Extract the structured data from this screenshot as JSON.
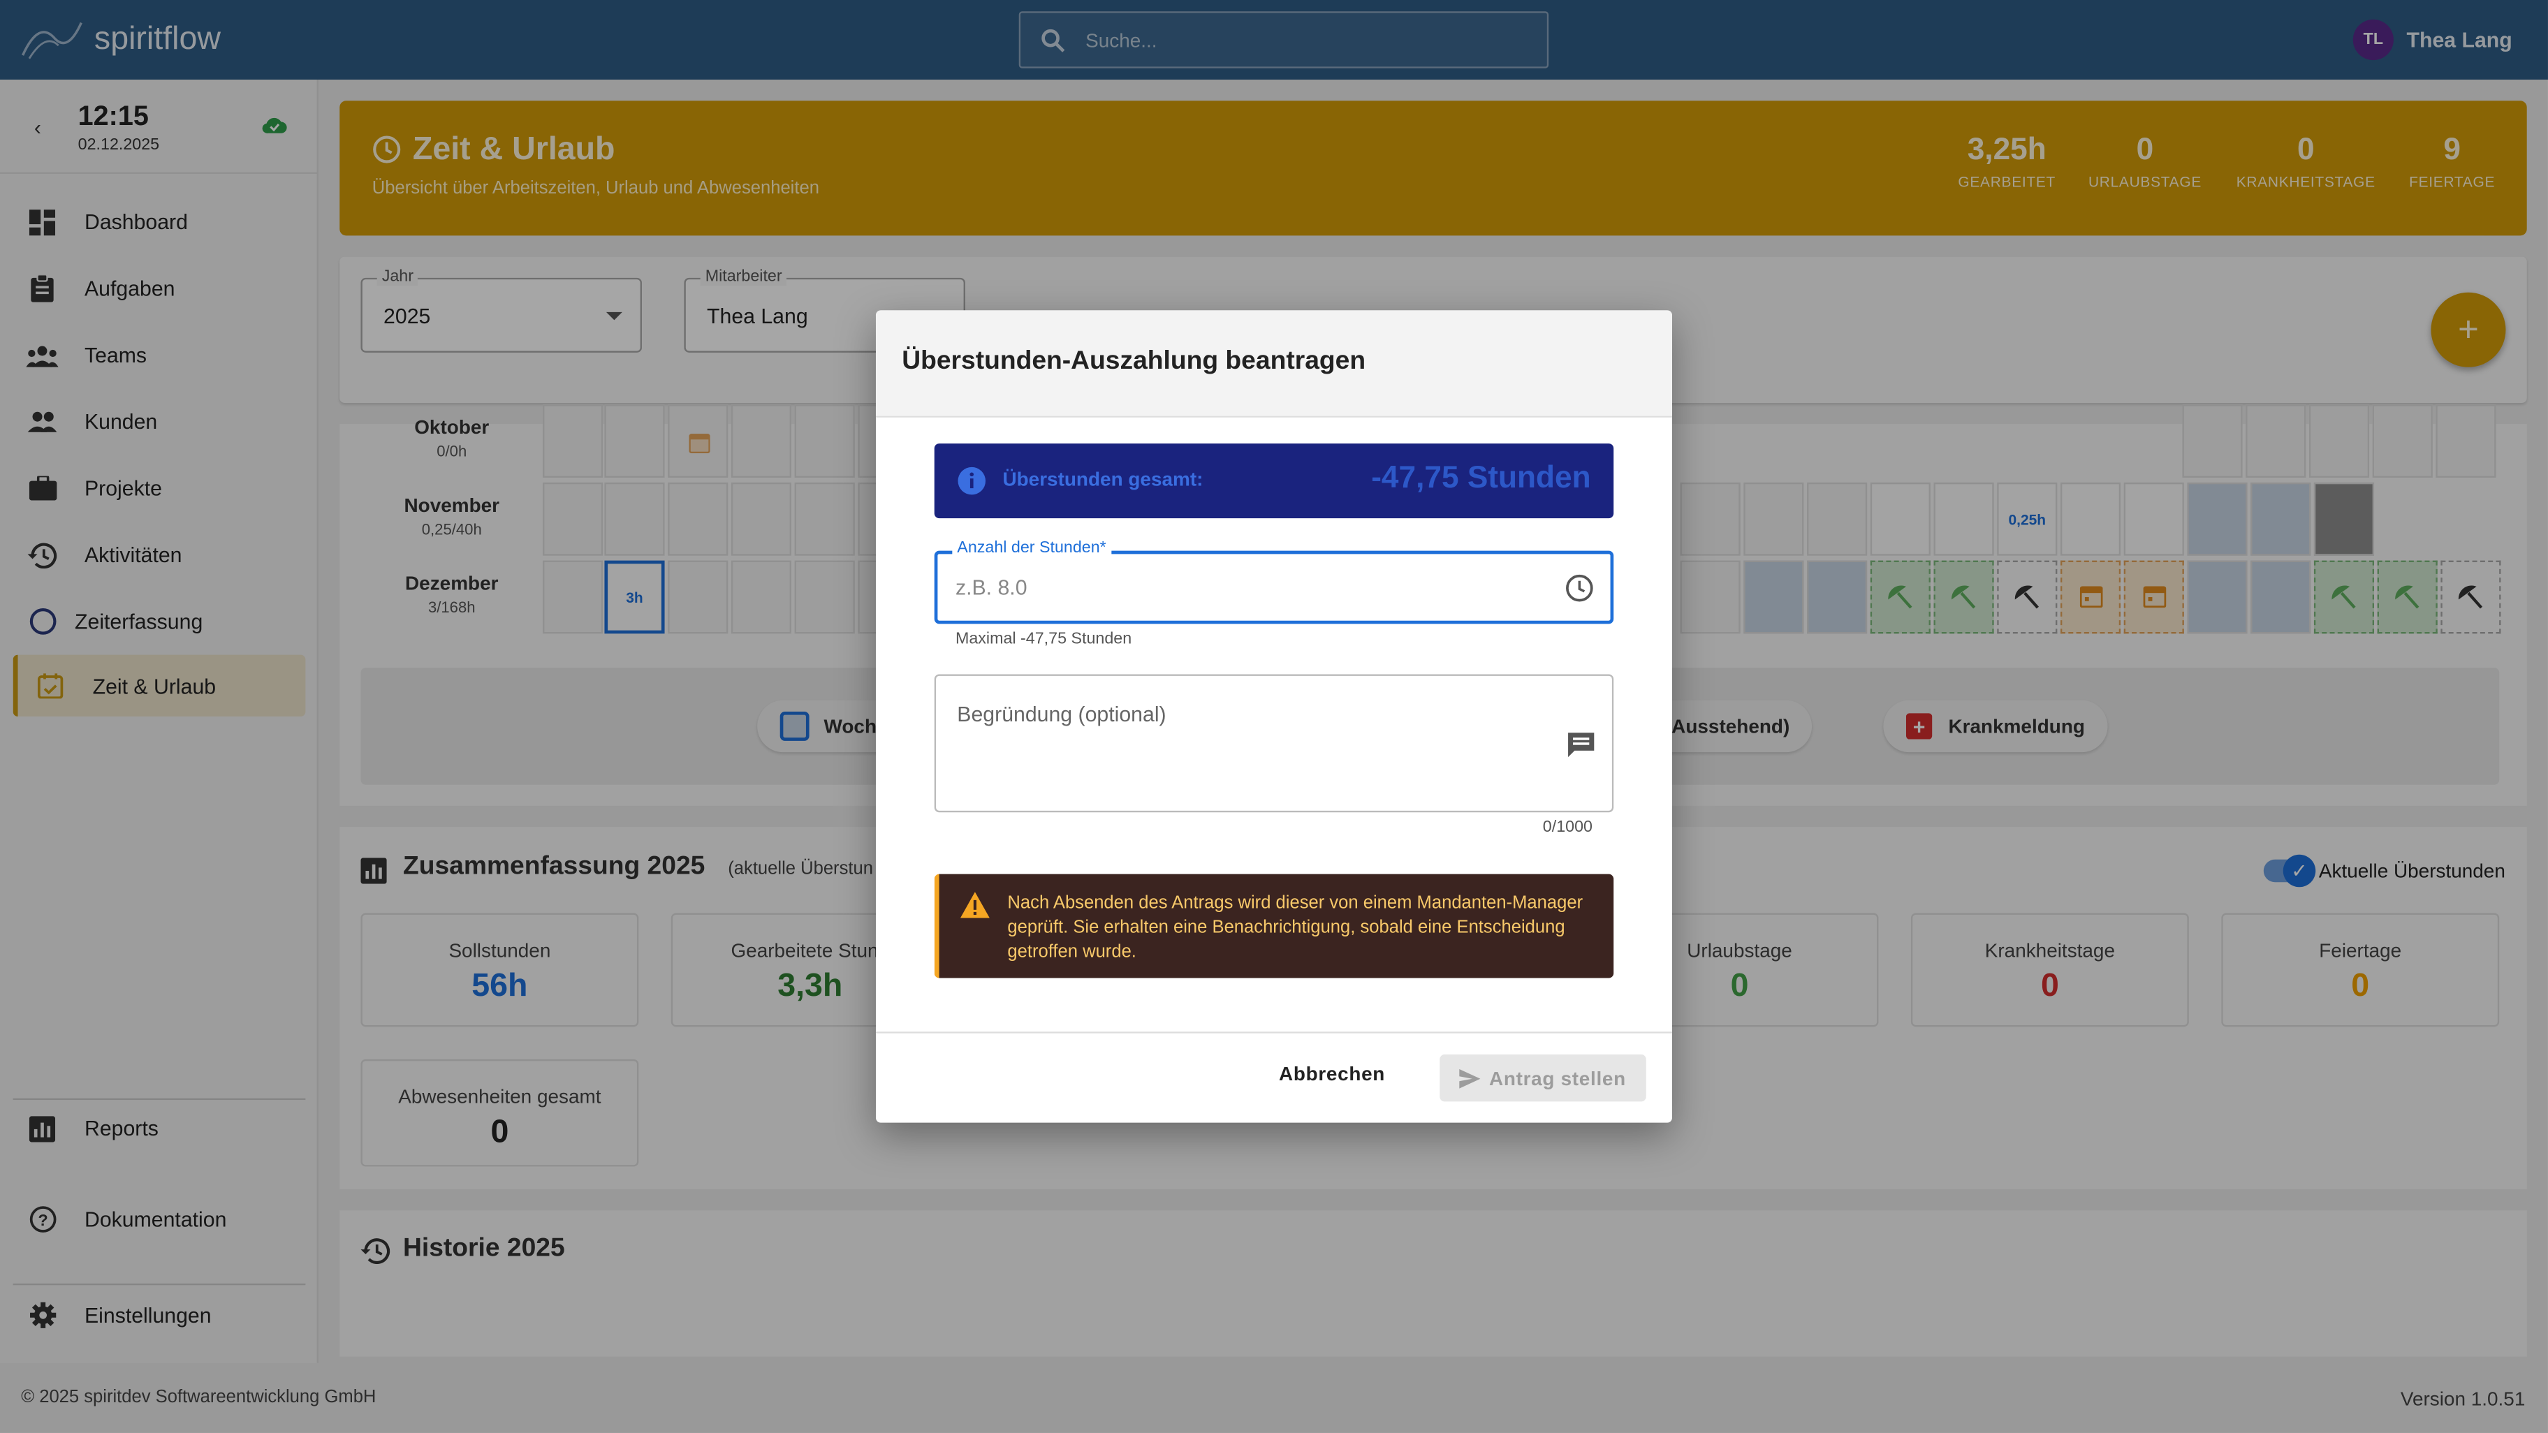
{
  "app": {
    "name": "spiritflow"
  },
  "search": {
    "placeholder": "Suche..."
  },
  "user": {
    "initials": "TL",
    "name": "Thea Lang"
  },
  "clock": {
    "time": "12:15",
    "date": "02.12.2025"
  },
  "sidebar": {
    "items": [
      {
        "label": "Dashboard",
        "icon": "dashboard-icon"
      },
      {
        "label": "Aufgaben",
        "icon": "clipboard-icon"
      },
      {
        "label": "Teams",
        "icon": "teams-icon"
      },
      {
        "label": "Kunden",
        "icon": "people-icon"
      },
      {
        "label": "Projekte",
        "icon": "briefcase-icon"
      },
      {
        "label": "Aktivitäten",
        "icon": "history-icon"
      },
      {
        "label": "Zeiterfassung",
        "icon": "circle-icon"
      },
      {
        "label": "Zeit & Urlaub",
        "icon": "calendar-check-icon",
        "active": true
      }
    ],
    "bottom": [
      {
        "label": "Reports",
        "icon": "bar-chart-icon"
      },
      {
        "label": "Dokumentation",
        "icon": "help-icon"
      },
      {
        "label": "Einstellungen",
        "icon": "gear-icon"
      }
    ]
  },
  "header": {
    "title": "Zeit & Urlaub",
    "subtitle": "Übersicht über Arbeitszeiten, Urlaub und Abwesenheiten",
    "stats": [
      {
        "value": "3,25h",
        "label": "GEARBEITET"
      },
      {
        "value": "0",
        "label": "URLAUBSTAGE"
      },
      {
        "value": "0",
        "label": "KRANKHEITSTAGE"
      },
      {
        "value": "9",
        "label": "FEIERTAGE"
      }
    ]
  },
  "filters": {
    "year_label": "Jahr",
    "year_value": "2025",
    "employee_label": "Mitarbeiter",
    "employee_value": "Thea Lang"
  },
  "calendar": {
    "months": [
      {
        "name": "Oktober",
        "hours": "0/0h"
      },
      {
        "name": "November",
        "hours": "0,25/40h",
        "cell_text": "0,25h"
      },
      {
        "name": "Dezember",
        "hours": "3/168h",
        "cell_text": "3h"
      }
    ],
    "legend": [
      {
        "label": "Woche"
      },
      {
        "label": "o (Ausstehend)"
      },
      {
        "label": "Krankmeldung"
      }
    ]
  },
  "summary": {
    "title": "Zusammenfassung 2025",
    "subtitle": "(aktuelle Überstun",
    "toggle_label": "Aktuelle Überstunden",
    "stats": [
      {
        "label": "Sollstunden",
        "value": "56h",
        "color": "#1e6fd9"
      },
      {
        "label": "Gearbeitete Stund",
        "value": "3,3h",
        "color": "#2e7d32"
      },
      {
        "label": "Urlaubstage",
        "value": "0",
        "color": "#43a047"
      },
      {
        "label": "Krankheitstage",
        "value": "0",
        "color": "#d32f2f"
      },
      {
        "label": "Feiertage",
        "value": "0",
        "color": "#f0a000"
      },
      {
        "label": "Abwesenheiten gesamt",
        "value": "0",
        "color": "#222222"
      }
    ]
  },
  "history": {
    "title": "Historie 2025"
  },
  "dialog": {
    "title": "Überstunden-Auszahlung beantragen",
    "info_label": "Überstunden gesamt:",
    "info_value": "-47,75 Stunden",
    "hours_label": "Anzahl der Stunden*",
    "hours_placeholder": "z.B. 8.0",
    "hours_helper": "Maximal -47,75 Stunden",
    "reason_placeholder": "Begründung (optional)",
    "counter": "0/1000",
    "warning": "Nach Absenden des Antrags wird dieser von einem Mandanten-Manager geprüft. Sie erhalten eine Benachrichtigung, sobald eine Entscheidung getroffen wurde.",
    "cancel": "Abbrechen",
    "submit": "Antrag stellen"
  },
  "footer": {
    "copyright": "© 2025 spiritdev Softwareentwicklung GmbH",
    "version": "Version 1.0.51"
  },
  "colors": {
    "topbar": "#2e5c86",
    "accent": "#d39b09",
    "info_bg": "#1a237e",
    "warning_bg": "#3b2420"
  }
}
